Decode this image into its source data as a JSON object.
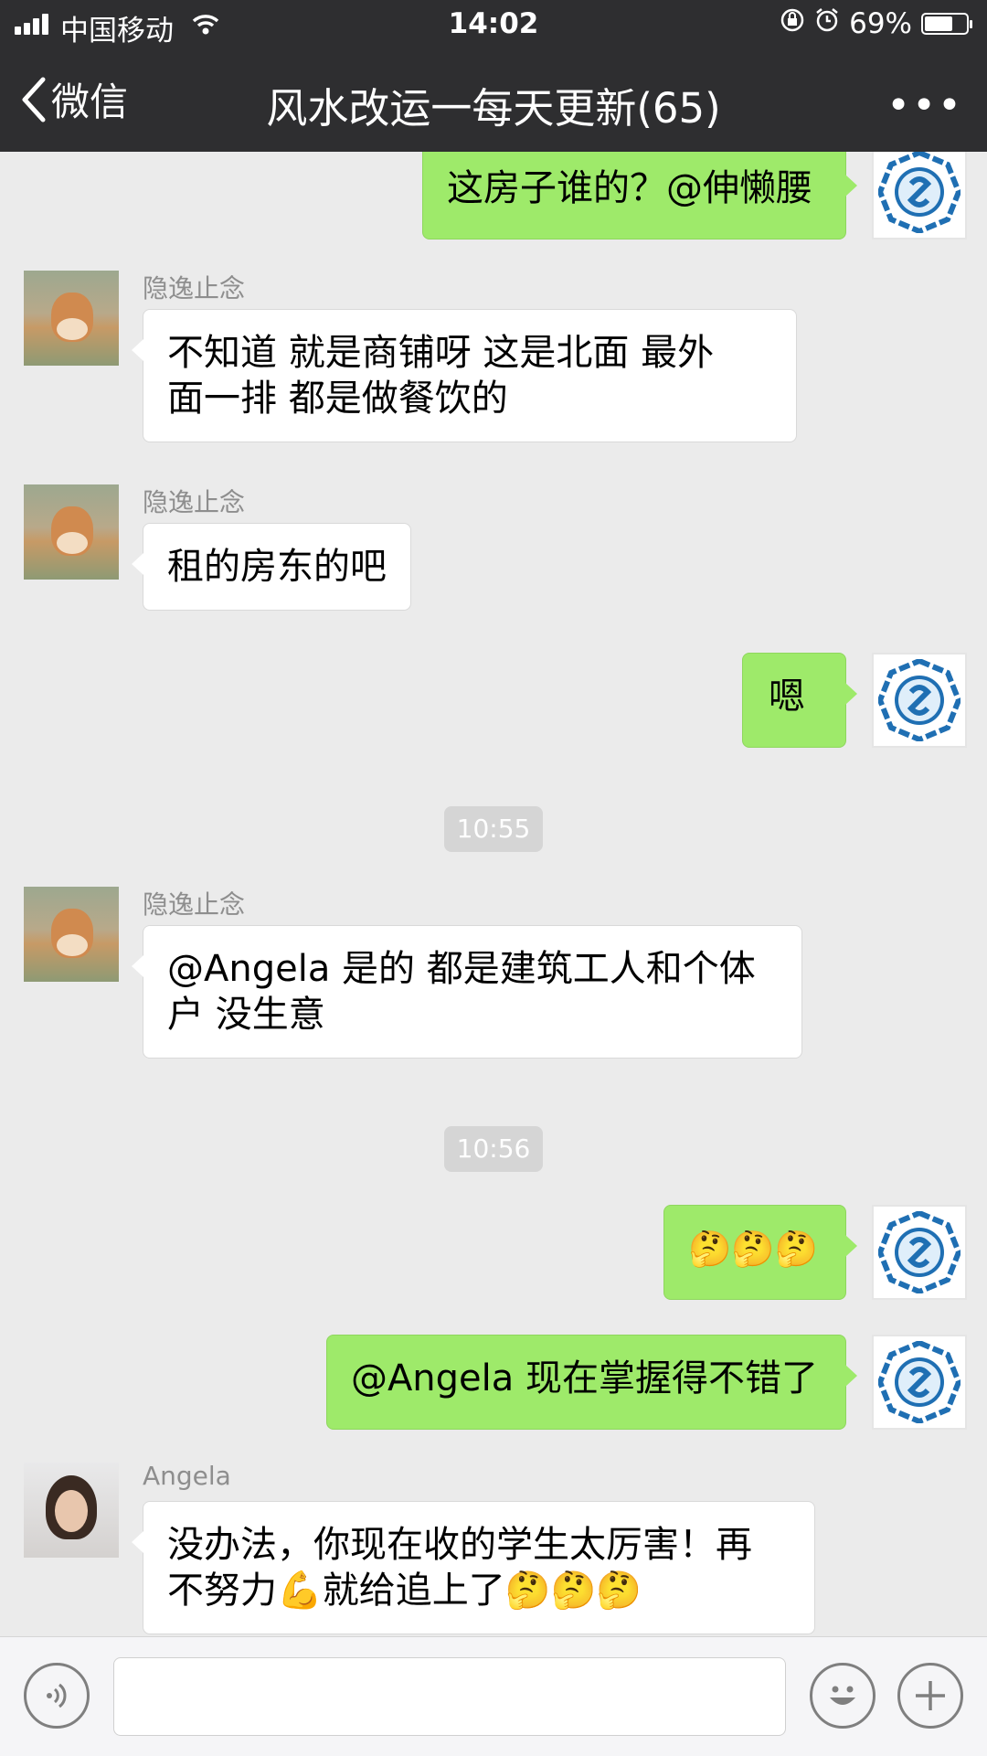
{
  "status_bar": {
    "carrier": "中国移动",
    "time": "14:02",
    "battery_percent": "69%",
    "battery_level": 0.69
  },
  "nav": {
    "back_label": "微信",
    "title": "风水改运一每天更新(65)",
    "more_label": "•••"
  },
  "messages": [
    {
      "side": "out",
      "text": "这房子谁的？@伸懒腰"
    },
    {
      "side": "in",
      "sender": "隐逸止念",
      "lines": [
        "不知道  就是商铺呀  这是北面  最外",
        "面一排 都是做餐饮的"
      ]
    },
    {
      "side": "in",
      "sender": "隐逸止念",
      "text": "租的房东的吧"
    },
    {
      "side": "out",
      "text": "嗯"
    },
    {
      "type": "time",
      "text": "10:55"
    },
    {
      "side": "in",
      "sender": "隐逸止念",
      "lines": [
        "@Angela 是的  都是建筑工人和个体",
        "户  没生意"
      ]
    },
    {
      "type": "time",
      "text": "10:56"
    },
    {
      "side": "out",
      "text": "🤔🤔🤔"
    },
    {
      "side": "out",
      "text": "@Angela 现在掌握得不错了"
    },
    {
      "side": "in",
      "sender": "Angela",
      "lines": [
        "没办法，你现在收的学生太厉害！再",
        "不努力💪就给追上了🤔🤔🤔"
      ]
    }
  ],
  "input": {
    "placeholder": ""
  },
  "colors": {
    "nav_bg": "#2e2e30",
    "bubble_out": "#9eea6a",
    "bubble_in": "#ffffff",
    "chat_bg": "#ebebeb"
  },
  "icons": {
    "voice": "voice-icon",
    "emoji": "emoji-icon",
    "plus": "plus-icon",
    "back": "chevron-left-icon"
  }
}
